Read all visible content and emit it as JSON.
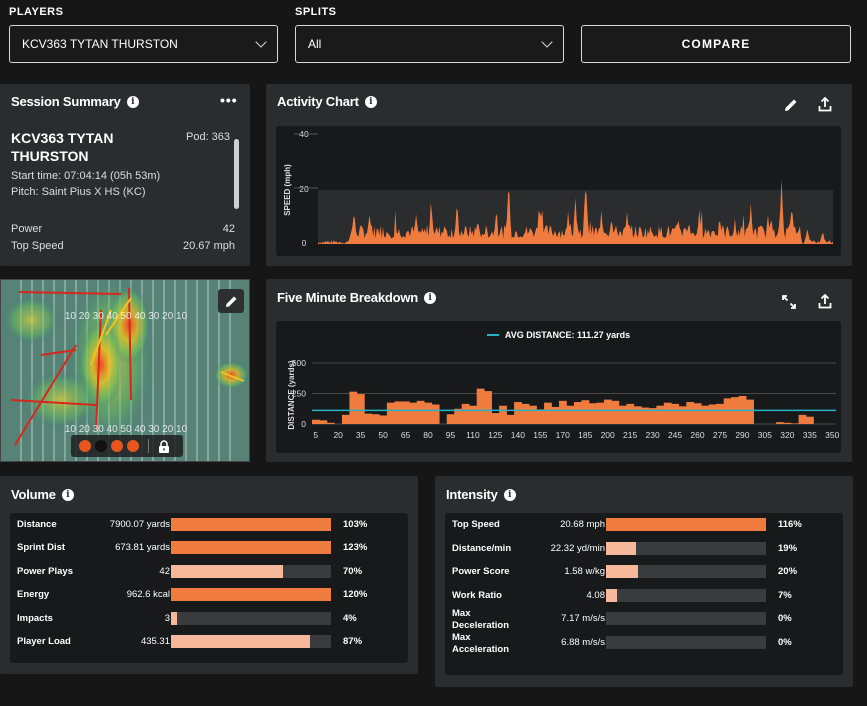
{
  "header": {
    "players_label": "PLAYERS",
    "players_value": "KCV363 TYTAN THURSTON",
    "splits_label": "SPLITS",
    "splits_value": "All",
    "compare_label": "COMPARE"
  },
  "session": {
    "title": "Session Summary",
    "name_line1": "KCV363 TYTAN",
    "name_line2": "THURSTON",
    "pod": "Pod: 363",
    "start_time": "Start time: 07:04:14 (05h 53m)",
    "pitch": "Pitch: Saint Pius X HS (KC)",
    "power_label": "Power",
    "power_value": "42",
    "top_speed_label": "Top Speed",
    "top_speed_value": "20.67 mph"
  },
  "heatmap": {
    "field_numbers_top": "10 20 30 40 50 40 30 20 10",
    "field_numbers_bottom": "10 20 30 40 50 40 30 20 10",
    "dots": [
      "#e8561f",
      "#111111",
      "#e8561f",
      "#e8561f"
    ]
  },
  "activity": {
    "title": "Activity Chart",
    "ylabel": "SPEED (mph)",
    "yticks": [
      "40",
      "20",
      "0"
    ],
    "ylim": [
      0,
      40
    ],
    "bar_color": "#f07b3f"
  },
  "breakdown": {
    "title": "Five Minute Breakdown",
    "legend": "AVG DISTANCE: 111.27 yards",
    "ylabel": "DISTANCE (yards)",
    "avg_color": "#27b3c4",
    "bar_color": "#f07b3f"
  },
  "chart_data": [
    {
      "type": "bar",
      "title": "Five Minute Breakdown",
      "ylabel": "DISTANCE (yards)",
      "ylim": [
        0,
        500
      ],
      "yticks": [
        "500",
        "250",
        "0"
      ],
      "average": 111.27,
      "categories": [
        "5",
        "10",
        "15",
        "20",
        "25",
        "30",
        "35",
        "40",
        "45",
        "50",
        "55",
        "60",
        "65",
        "70",
        "75",
        "80",
        "85",
        "90",
        "95",
        "100",
        "105",
        "110",
        "115",
        "120",
        "125",
        "130",
        "135",
        "140",
        "145",
        "150",
        "155",
        "160",
        "165",
        "170",
        "175",
        "180",
        "185",
        "190",
        "195",
        "200",
        "205",
        "210",
        "215",
        "220",
        "225",
        "230",
        "235",
        "240",
        "245",
        "250",
        "255",
        "260",
        "265",
        "270",
        "275",
        "280",
        "285",
        "290",
        "295",
        "300",
        "305",
        "310",
        "315",
        "320",
        "325",
        "330",
        "335",
        "340",
        "345",
        "350"
      ],
      "tick_labels": [
        "5",
        "20",
        "35",
        "50",
        "65",
        "80",
        "95",
        "110",
        "125",
        "140",
        "155",
        "170",
        "185",
        "200",
        "215",
        "230",
        "245",
        "260",
        "275",
        "290",
        "305",
        "320",
        "335",
        "350"
      ],
      "values": [
        35,
        30,
        10,
        0,
        75,
        265,
        245,
        85,
        80,
        70,
        175,
        185,
        185,
        175,
        190,
        175,
        160,
        0,
        80,
        125,
        165,
        150,
        290,
        270,
        90,
        150,
        75,
        180,
        165,
        150,
        120,
        175,
        140,
        190,
        150,
        180,
        195,
        170,
        175,
        200,
        190,
        150,
        165,
        145,
        135,
        130,
        150,
        175,
        165,
        145,
        180,
        170,
        150,
        160,
        165,
        210,
        220,
        230,
        200,
        0,
        0,
        0,
        15,
        10,
        5,
        75,
        60,
        0,
        0,
        0
      ]
    },
    {
      "type": "area",
      "title": "Activity Chart",
      "ylabel": "SPEED (mph)",
      "ylim": [
        0,
        40
      ]
    }
  ],
  "volume": {
    "title": "Volume",
    "rows": [
      {
        "label": "Distance",
        "value": "7900.07 yards",
        "pct": "103%",
        "fill": 1.0,
        "color": "#f07b3f"
      },
      {
        "label": "Sprint Dist",
        "value": "673.81 yards",
        "pct": "123%",
        "fill": 1.0,
        "color": "#f07b3f"
      },
      {
        "label": "Power Plays",
        "value": "42",
        "pct": "70%",
        "fill": 0.7,
        "color": "#f5b89a"
      },
      {
        "label": "Energy",
        "value": "962.6 kcal",
        "pct": "120%",
        "fill": 1.0,
        "color": "#f07b3f"
      },
      {
        "label": "Impacts",
        "value": "3",
        "pct": "4%",
        "fill": 0.04,
        "color": "#f5b89a"
      },
      {
        "label": "Player Load",
        "value": "435.31",
        "pct": "87%",
        "fill": 0.87,
        "color": "#f5b89a"
      }
    ]
  },
  "intensity": {
    "title": "Intensity",
    "rows": [
      {
        "label": "Top Speed",
        "label2": "",
        "value": "20.68 mph",
        "pct": "116%",
        "fill": 1.0,
        "color": "#f07b3f"
      },
      {
        "label": "Distance/min",
        "label2": "",
        "value": "22.32 yd/min",
        "pct": "19%",
        "fill": 0.19,
        "color": "#f5b89a"
      },
      {
        "label": "Power Score",
        "label2": "",
        "value": "1.58 w/kg",
        "pct": "20%",
        "fill": 0.2,
        "color": "#f5b89a"
      },
      {
        "label": "Work Ratio",
        "label2": "",
        "value": "4.08",
        "pct": "7%",
        "fill": 0.07,
        "color": "#f5b89a"
      },
      {
        "label": "Max",
        "label2": "Deceleration",
        "value": "7.17 m/s/s",
        "pct": "0%",
        "fill": 0,
        "color": "#f5b89a"
      },
      {
        "label": "Max",
        "label2": "Acceleration",
        "value": "6.88 m/s/s",
        "pct": "0%",
        "fill": 0,
        "color": "#f5b89a"
      }
    ]
  }
}
